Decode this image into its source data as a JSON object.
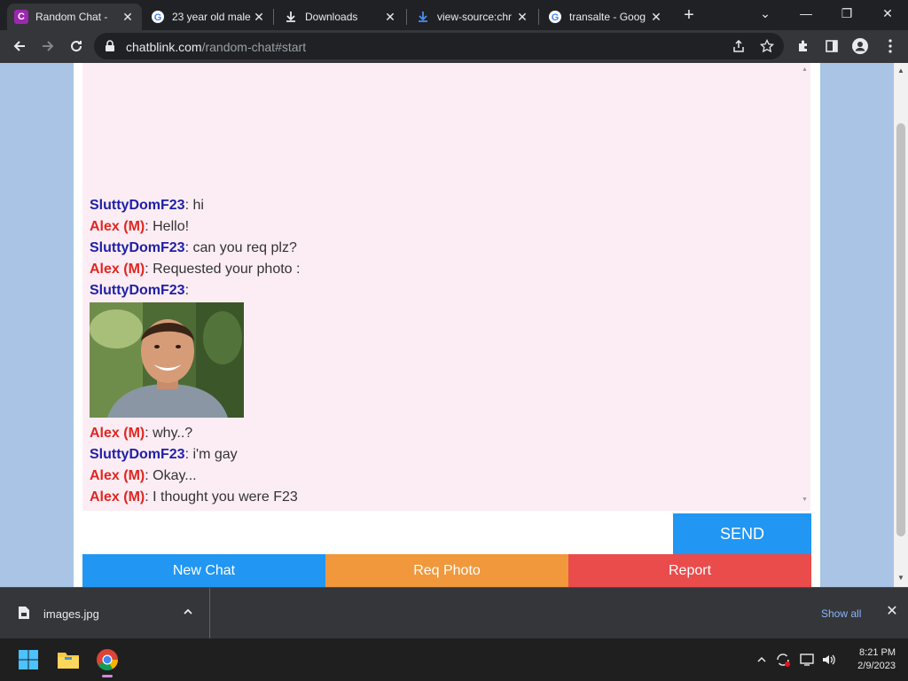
{
  "browser": {
    "tabs": [
      {
        "title": "Random Chat -",
        "favicon": "chatblink-c-icon",
        "active": true
      },
      {
        "title": "23 year old male",
        "favicon": "google-g-icon",
        "active": false
      },
      {
        "title": "Downloads",
        "favicon": "download-icon",
        "active": false
      },
      {
        "title": "view-source:chr",
        "favicon": "download-icon",
        "active": false
      },
      {
        "title": "transalte - Goog",
        "favicon": "google-g-icon",
        "active": false
      }
    ],
    "url": {
      "host": "chatblink.com",
      "path": "/random-chat#start"
    }
  },
  "chat": {
    "stranger_name": "SluttyDomF23",
    "my_name": "Alex (M)",
    "messages": [
      {
        "sender": "stranger",
        "name": "SluttyDomF23",
        "text": ": hi"
      },
      {
        "sender": "me",
        "name": "Alex (M)",
        "text": ": Hello!"
      },
      {
        "sender": "stranger",
        "name": "SluttyDomF23",
        "text": ": can you req plz?"
      },
      {
        "sender": "me",
        "name": "Alex (M)",
        "text": ": Requested your photo :"
      },
      {
        "sender": "stranger",
        "name": "SluttyDomF23",
        "text": ":"
      },
      {
        "sender": "me",
        "name": "Alex (M)",
        "text": ": why..?"
      },
      {
        "sender": "stranger",
        "name": "SluttyDomF23",
        "text": ": i'm gay"
      },
      {
        "sender": "me",
        "name": "Alex (M)",
        "text": ": Okay..."
      },
      {
        "sender": "me",
        "name": "Alex (M)",
        "text": ": I thought you were F23"
      }
    ],
    "input_value": "",
    "send_label": "SEND",
    "actions": {
      "new_chat": "New Chat",
      "req_photo": "Req Photo",
      "report": "Report"
    }
  },
  "downloads": {
    "file_name": "images.jpg",
    "show_all": "Show all"
  },
  "taskbar": {
    "time": "8:21 PM",
    "date": "2/9/2023"
  },
  "colors": {
    "stranger": "#1f1fa8",
    "me": "#e0261f",
    "send": "#2196f3",
    "new_chat": "#2196f3",
    "req_photo": "#f0983b",
    "report": "#ea4b4b",
    "chat_bg": "#fcedf4",
    "page_bg": "#a9c4e4"
  }
}
